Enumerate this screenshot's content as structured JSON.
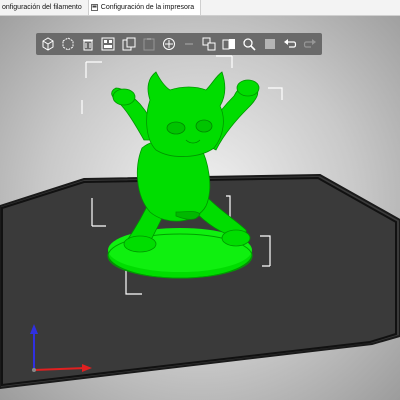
{
  "tabs": [
    {
      "label": "onfiguración del filamento",
      "active": false,
      "icon": "filament-icon"
    },
    {
      "label": "Configuración de la impresora",
      "active": true,
      "icon": "printer-settings-icon"
    }
  ],
  "toolbar": {
    "buttons": [
      {
        "name": "add-object-button",
        "icon": "cube-add-icon",
        "enabled": true
      },
      {
        "name": "delete-button",
        "icon": "cube-delete-icon",
        "enabled": true
      },
      {
        "name": "delete-all-button",
        "icon": "trash-icon",
        "enabled": true
      },
      {
        "name": "arrange-button",
        "icon": "arrange-icon",
        "enabled": true
      },
      {
        "name": "copy-button",
        "icon": "copy-icon",
        "enabled": true
      },
      {
        "name": "paste-button",
        "icon": "paste-icon",
        "enabled": false
      },
      {
        "name": "add-instance-button",
        "icon": "plus-circle-icon",
        "enabled": true
      },
      {
        "name": "remove-instance-button",
        "icon": "minus-icon",
        "enabled": false
      },
      {
        "name": "split-objects-button",
        "icon": "split-objects-icon",
        "enabled": true
      },
      {
        "name": "split-parts-button",
        "icon": "split-parts-icon",
        "enabled": true
      },
      {
        "name": "search-button",
        "icon": "search-icon",
        "enabled": true
      },
      {
        "name": "layers-button",
        "icon": "layers-icon",
        "enabled": true
      },
      {
        "name": "undo-button",
        "icon": "undo-icon",
        "enabled": true
      },
      {
        "name": "redo-button",
        "icon": "redo-icon",
        "enabled": false
      }
    ]
  },
  "scene": {
    "model_color": "#00dd00",
    "bed_color": "#3b3b3b",
    "bed_border_color": "#1a1a1a",
    "selection_box_color": "#ffffff",
    "axes": {
      "x_color": "#e02020",
      "z_color": "#3030e0"
    }
  }
}
